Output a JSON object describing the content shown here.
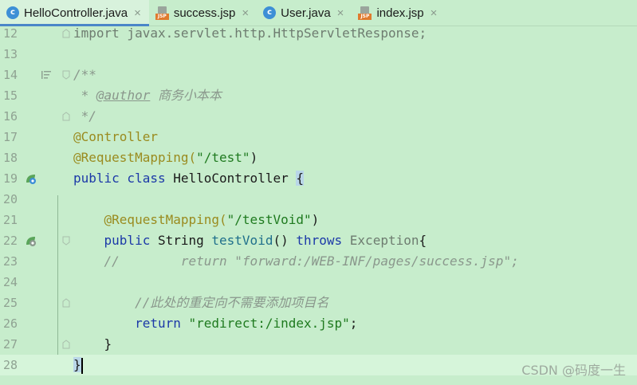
{
  "tabs": [
    {
      "label": "HelloController.java",
      "icon": "java-class-icon",
      "active": true
    },
    {
      "label": "success.jsp",
      "icon": "jsp-file-icon",
      "active": false
    },
    {
      "label": "User.java",
      "icon": "java-class-icon",
      "active": false
    },
    {
      "label": "index.jsp",
      "icon": "jsp-file-icon",
      "active": false
    }
  ],
  "tab_close_glyph": "×",
  "lines": {
    "l12": {
      "num": "12",
      "t": [
        "import javax.servlet.http.HttpServletResponse;"
      ]
    },
    "l13": {
      "num": "13"
    },
    "l14": {
      "num": "14",
      "t": [
        "/**"
      ]
    },
    "l15": {
      "num": "15",
      "t": [
        " * ",
        "@author",
        " 商务小本本"
      ]
    },
    "l16": {
      "num": "16",
      "t": [
        " */"
      ]
    },
    "l17": {
      "num": "17",
      "t": [
        "@Controller"
      ]
    },
    "l18": {
      "num": "18",
      "t": [
        "@RequestMapping(",
        "\"/test\"",
        ")"
      ]
    },
    "l19": {
      "num": "19",
      "t": [
        "public class",
        " HelloController ",
        "{"
      ]
    },
    "l20": {
      "num": "20"
    },
    "l21": {
      "num": "21",
      "t": [
        "    @RequestMapping(",
        "\"/testVoid\"",
        ")"
      ]
    },
    "l22": {
      "num": "22",
      "t": [
        "    public",
        " String ",
        "testVoid",
        "() ",
        "throws",
        " Exception",
        "{"
      ]
    },
    "l23": {
      "num": "23",
      "t": [
        "    //        return \"forward:/WEB-INF/pages/success.jsp\";"
      ]
    },
    "l24": {
      "num": "24"
    },
    "l25": {
      "num": "25",
      "t": [
        "        //此处的重定向不需要添加项目名"
      ]
    },
    "l26": {
      "num": "26",
      "t": [
        "        return ",
        "\"redirect:/index.jsp\"",
        ";"
      ]
    },
    "l27": {
      "num": "27",
      "t": [
        "    }"
      ]
    },
    "l28": {
      "num": "28",
      "t": [
        "}"
      ]
    }
  },
  "watermark": "CSDN @码度一生",
  "colors": {
    "background": "#c7edcc",
    "keyword": "#1c39a8",
    "string": "#1f7a1f",
    "annotation": "#9a8b1f",
    "comment": "#8a978c"
  }
}
